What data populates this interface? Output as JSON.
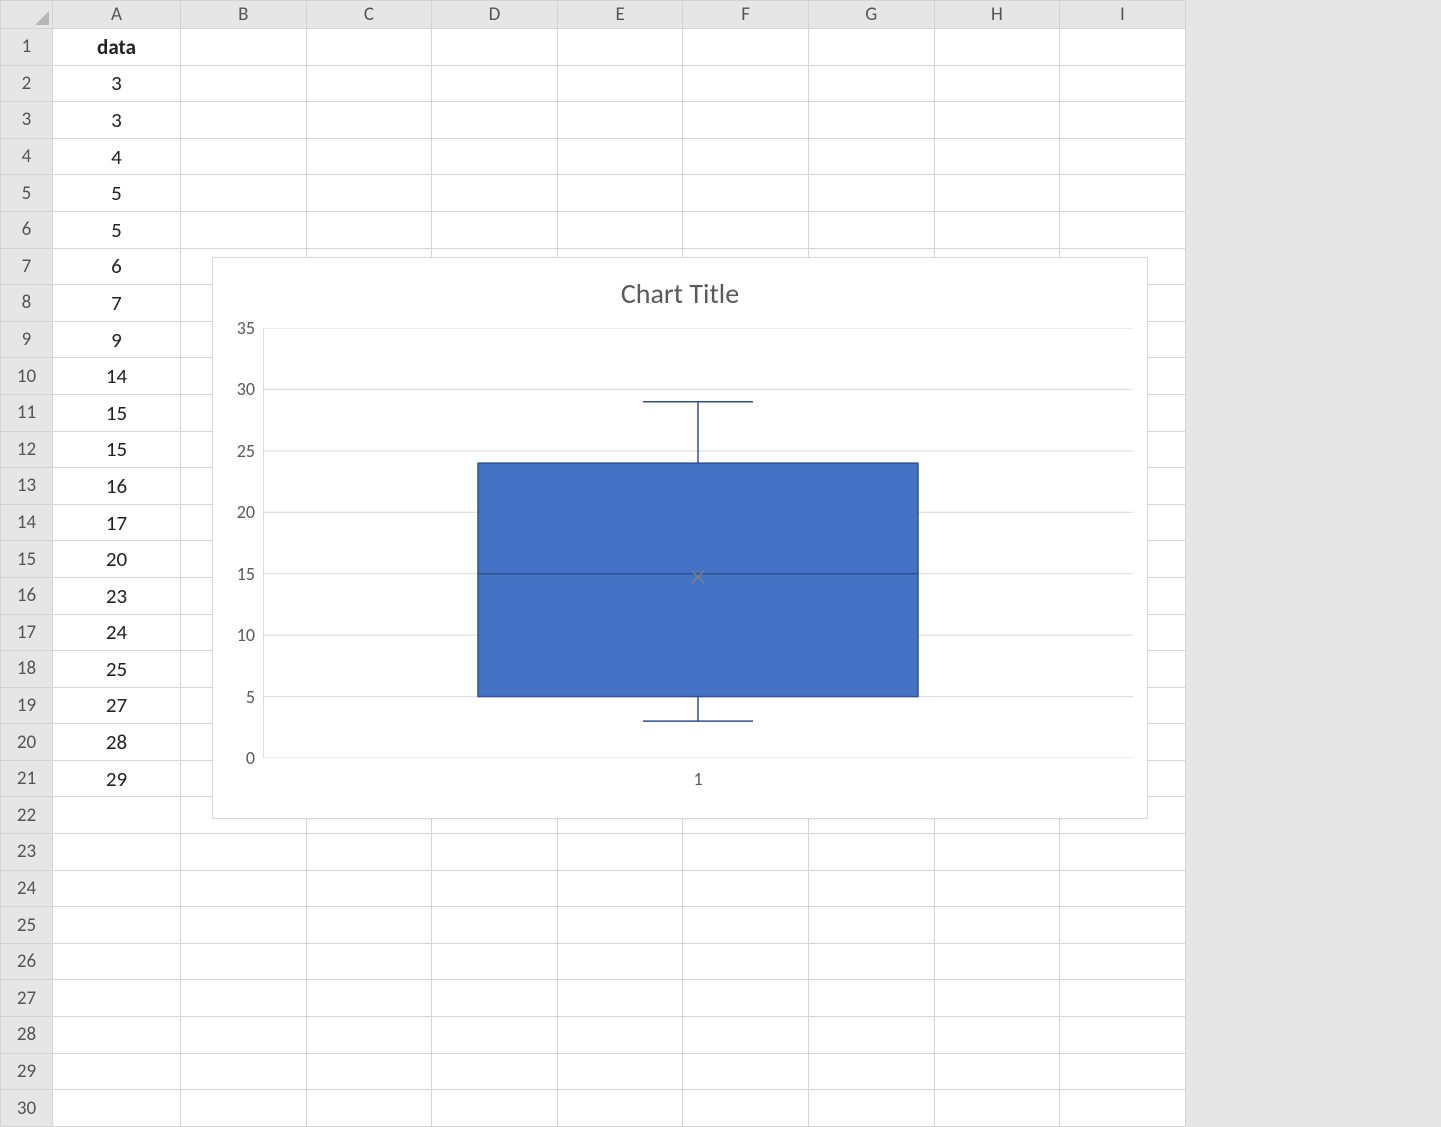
{
  "columns": [
    "A",
    "B",
    "C",
    "D",
    "E",
    "F",
    "G",
    "H",
    "I"
  ],
  "row_count": 30,
  "cells": {
    "A1": {
      "value": "data",
      "bold": true
    },
    "A2": {
      "value": "3"
    },
    "A3": {
      "value": "3"
    },
    "A4": {
      "value": "4"
    },
    "A5": {
      "value": "5"
    },
    "A6": {
      "value": "5"
    },
    "A7": {
      "value": "6"
    },
    "A8": {
      "value": "7"
    },
    "A9": {
      "value": "9"
    },
    "A10": {
      "value": "14"
    },
    "A11": {
      "value": "15"
    },
    "A12": {
      "value": "15"
    },
    "A13": {
      "value": "16"
    },
    "A14": {
      "value": "17"
    },
    "A15": {
      "value": "20"
    },
    "A16": {
      "value": "23"
    },
    "A17": {
      "value": "24"
    },
    "A18": {
      "value": "25"
    },
    "A19": {
      "value": "27"
    },
    "A20": {
      "value": "28"
    },
    "A21": {
      "value": "29"
    }
  },
  "chart_data": {
    "type": "box",
    "title": "Chart Title",
    "categories": [
      "1"
    ],
    "series": [
      {
        "name": "data",
        "min": 3,
        "q1": 5,
        "median": 15,
        "mean": 14.75,
        "q3": 24,
        "max": 29
      }
    ],
    "ylim": [
      0,
      35
    ],
    "yticks": [
      0,
      5,
      10,
      15,
      20,
      25,
      30,
      35
    ],
    "box_color": "#4472C4",
    "box_border": "#2F528F",
    "grid_color": "#d9d9d9"
  }
}
